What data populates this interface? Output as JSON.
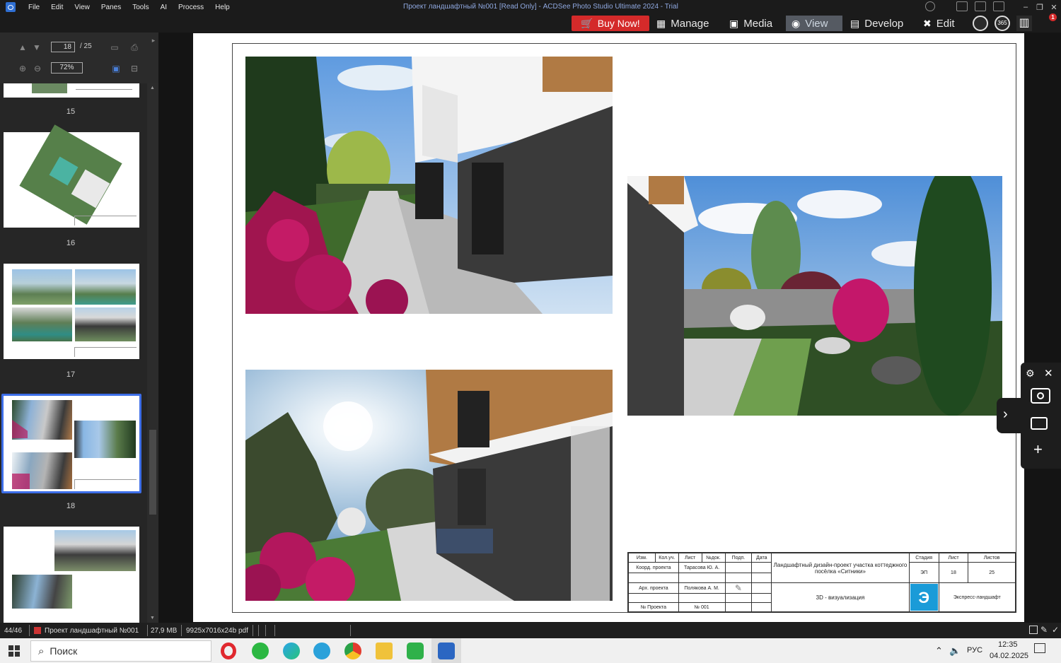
{
  "window": {
    "title": "Проект ландшафтный №001 [Read Only] - ACDSee Photo Studio Ultimate 2024 - Trial",
    "menu": [
      "File",
      "Edit",
      "View",
      "Panes",
      "Tools",
      "AI",
      "Process",
      "Help"
    ]
  },
  "modes": {
    "buy": "Buy Now!",
    "manage": "Manage",
    "media": "Media",
    "view": "View",
    "develop": "Develop",
    "edit": "Edit",
    "badge365": "365",
    "notif_count": "1"
  },
  "nav": {
    "page": "18",
    "total": "/ 25",
    "zoom": "72%"
  },
  "thumbnails": [
    {
      "label": "15"
    },
    {
      "label": "16"
    },
    {
      "label": "17"
    },
    {
      "label": "18",
      "selected": true
    },
    {
      "label": ""
    }
  ],
  "stamp": {
    "h_izm": "Изм.",
    "h_kol": "Кол.уч.",
    "h_list": "Лист",
    "h_ndok": "№док.",
    "h_podp": "Подп.",
    "h_data": "Дата",
    "koord_label": "Коорд. проекта",
    "koord_name": "Тарасова Ю. А.",
    "arch_label": "Арх. проекта",
    "arch_name": "Полякова А. М.",
    "proj_label": "№ Проекта",
    "proj_no": "№ 001",
    "title": "Ландшафтный дизайн-проект участка коттеджного посёлка «Ситники»",
    "subtitle": "3D - визуализация",
    "stage_h": "Стадия",
    "sheet_h": "Лист",
    "sheets_h": "Листов",
    "stage": "ЭП",
    "sheet": "18",
    "sheets": "25",
    "company": "Экспресс-ландшафт"
  },
  "status": {
    "index": "44/46",
    "file": "Проект ландшафтный №001",
    "size": "27,9 MB",
    "dims": "9925x7016x24b pdf"
  },
  "taskbar": {
    "search": "Поиск",
    "lang": "РУС",
    "time": "12:35",
    "date": "04.02.2025"
  }
}
